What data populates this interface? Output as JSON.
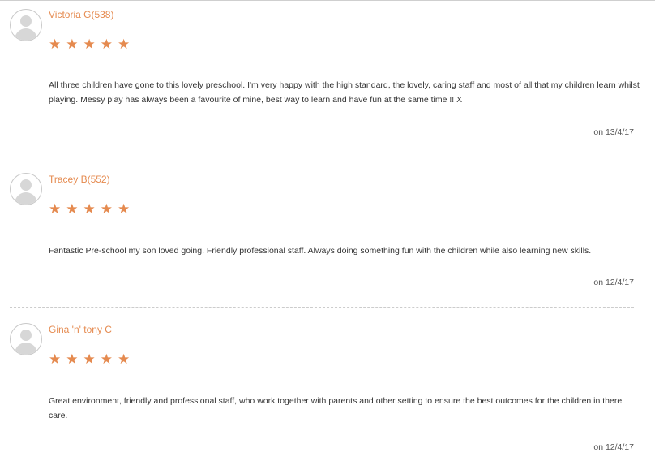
{
  "reviews": [
    {
      "reviewer": "Victoria G(538)",
      "rating_stars": 5,
      "text": "All three children have gone to this lovely preschool. I'm very happy with the high standard, the lovely, caring staff and most of all that my children learn whilst playing. Messy play has always been a favourite of mine, best way to learn and have fun at the same time !! X",
      "date": "on 13/4/17"
    },
    {
      "reviewer": "Tracey B(552)",
      "rating_stars": 5,
      "text": "Fantastic Pre-school my son loved going. Friendly professional staff. Always doing something fun with the children while also learning new skills.",
      "date": "on 12/4/17"
    },
    {
      "reviewer": "Gina 'n' tony C",
      "rating_stars": 5,
      "text": "Great environment, friendly and professional staff, who work together with parents and other setting to ensure the best outcomes for the children in there care.",
      "date": "on 12/4/17"
    }
  ],
  "star_glyph": "★",
  "colors": {
    "accent": "#e58a4f",
    "text": "#333333",
    "divider": "#cccccc"
  }
}
